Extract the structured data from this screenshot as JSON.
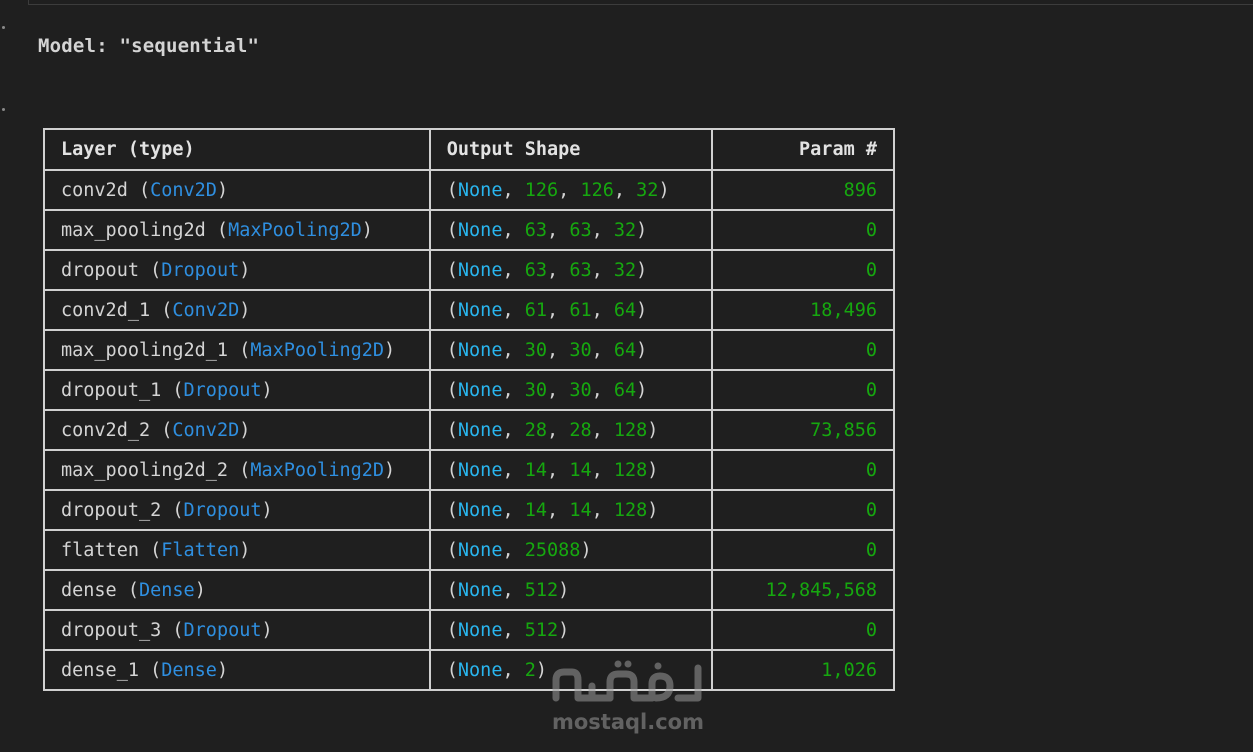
{
  "model": {
    "title": "Model: \"sequential\""
  },
  "table": {
    "headers": {
      "layer": "Layer (type)",
      "shape": "Output Shape",
      "param": "Param #"
    },
    "rows": [
      {
        "name": "conv2d",
        "type": "Conv2D",
        "shape": [
          "126",
          "126",
          "32"
        ],
        "params": "896"
      },
      {
        "name": "max_pooling2d",
        "type": "MaxPooling2D",
        "shape": [
          "63",
          "63",
          "32"
        ],
        "params": "0"
      },
      {
        "name": "dropout",
        "type": "Dropout",
        "shape": [
          "63",
          "63",
          "32"
        ],
        "params": "0"
      },
      {
        "name": "conv2d_1",
        "type": "Conv2D",
        "shape": [
          "61",
          "61",
          "64"
        ],
        "params": "18,496"
      },
      {
        "name": "max_pooling2d_1",
        "type": "MaxPooling2D",
        "shape": [
          "30",
          "30",
          "64"
        ],
        "params": "0"
      },
      {
        "name": "dropout_1",
        "type": "Dropout",
        "shape": [
          "30",
          "30",
          "64"
        ],
        "params": "0"
      },
      {
        "name": "conv2d_2",
        "type": "Conv2D",
        "shape": [
          "28",
          "28",
          "128"
        ],
        "params": "73,856"
      },
      {
        "name": "max_pooling2d_2",
        "type": "MaxPooling2D",
        "shape": [
          "14",
          "14",
          "128"
        ],
        "params": "0"
      },
      {
        "name": "dropout_2",
        "type": "Dropout",
        "shape": [
          "14",
          "14",
          "128"
        ],
        "params": "0"
      },
      {
        "name": "flatten",
        "type": "Flatten",
        "shape": [
          "25088"
        ],
        "params": "0"
      },
      {
        "name": "dense",
        "type": "Dense",
        "shape": [
          "512"
        ],
        "params": "12,845,568"
      },
      {
        "name": "dropout_3",
        "type": "Dropout",
        "shape": [
          "512"
        ],
        "params": "0"
      },
      {
        "name": "dense_1",
        "type": "Dense",
        "shape": [
          "2"
        ],
        "params": "1,026"
      }
    ],
    "none_label": "None"
  },
  "watermark": {
    "text": "mostaql.com",
    "logo_text": "مستقل"
  },
  "colors": {
    "background": "#1f1f1f",
    "type_blue": "#2f8fe0",
    "none_blue": "#29b5ee",
    "number_green": "#16a80f"
  }
}
